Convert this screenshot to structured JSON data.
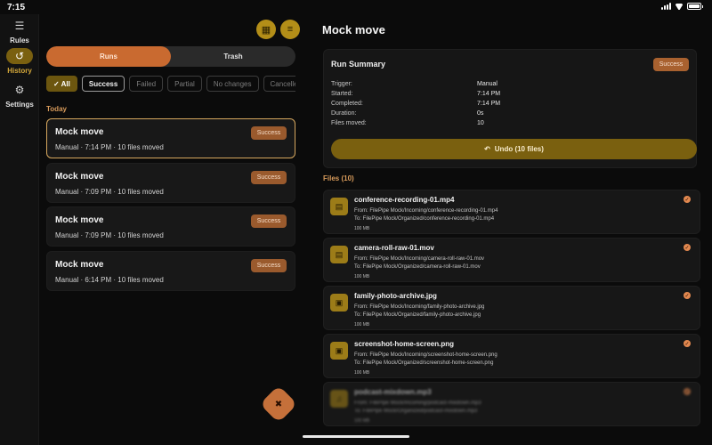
{
  "status_bar": {
    "time": "7:15"
  },
  "nav_rail": [
    {
      "label": "Rules",
      "icon": "sliders-icon",
      "glyph": "☰",
      "active": false
    },
    {
      "label": "History",
      "icon": "history-icon",
      "glyph": "↺",
      "active": true
    },
    {
      "label": "Settings",
      "icon": "gear-icon",
      "glyph": "⚙",
      "active": false
    }
  ],
  "toolbar": {
    "calendar_glyph": "▦",
    "sort_glyph": "≡"
  },
  "segments": [
    {
      "label": "Runs",
      "active": true
    },
    {
      "label": "Trash",
      "active": false
    }
  ],
  "filters": {
    "all": "✓ All",
    "success": "Success",
    "failed": "Failed",
    "partial": "Partial",
    "no_changes": "No changes",
    "cancelled": "Cancelled"
  },
  "section_today": "Today",
  "runs": [
    {
      "title": "Mock move",
      "subtitle": "Manual · 7:14 PM · 10 files moved",
      "status": "Success"
    },
    {
      "title": "Mock move",
      "subtitle": "Manual · 7:09 PM · 10 files moved",
      "status": "Success"
    },
    {
      "title": "Mock move",
      "subtitle": "Manual · 7:09 PM · 10 files moved",
      "status": "Success"
    },
    {
      "title": "Mock move",
      "subtitle": "Manual · 6:14 PM · 10 files moved",
      "status": "Success"
    }
  ],
  "fab_glyph": "✖",
  "detail": {
    "title": "Mock move",
    "summary": {
      "heading": "Run Summary",
      "status": "Success",
      "rows": [
        {
          "key": "Trigger:",
          "value": "Manual"
        },
        {
          "key": "Started:",
          "value": "7:14 PM"
        },
        {
          "key": "Completed:",
          "value": "7:14 PM"
        },
        {
          "key": "Duration:",
          "value": "0s"
        },
        {
          "key": "Files moved:",
          "value": "10"
        }
      ],
      "undo_glyph": "↶",
      "undo_label": "Undo (10 files)"
    },
    "files_heading": "Files (10)",
    "files": [
      {
        "name": "conference-recording-01.mp4",
        "from": "From: FilePipe Mock/Incoming/conference-recording-01.mp4",
        "to": "To: FilePipe Mock/Organized/conference-recording-01.mp4",
        "size": "100 MB",
        "icon": "video-icon",
        "glyph": "▤"
      },
      {
        "name": "camera-roll-raw-01.mov",
        "from": "From: FilePipe Mock/Incoming/camera-roll-raw-01.mov",
        "to": "To: FilePipe Mock/Organized/camera-roll-raw-01.mov",
        "size": "100 MB",
        "icon": "video-icon",
        "glyph": "▤"
      },
      {
        "name": "family-photo-archive.jpg",
        "from": "From: FilePipe Mock/Incoming/family-photo-archive.jpg",
        "to": "To: FilePipe Mock/Organized/family-photo-archive.jpg",
        "size": "100 MB",
        "icon": "image-icon",
        "glyph": "▣"
      },
      {
        "name": "screenshot-home-screen.png",
        "from": "From: FilePipe Mock/Incoming/screenshot-home-screen.png",
        "to": "To: FilePipe Mock/Organized/screenshot-home-screen.png",
        "size": "100 MB",
        "icon": "image-icon",
        "glyph": "▣"
      },
      {
        "name": "podcast-mixdown.mp3",
        "from": "From: FilePipe Mock/Incoming/podcast-mixdown.mp3",
        "to": "To: FilePipe Mock/Organized/podcast-mixdown.mp3",
        "size": "100 MB",
        "icon": "audio-icon",
        "glyph": "♫"
      }
    ],
    "check_glyph": "✓"
  },
  "colors": {
    "accent_gold": "#b38e18",
    "accent_orange": "#c96a30",
    "section_label": "#d89b5b",
    "background": "#0b0b0b"
  }
}
